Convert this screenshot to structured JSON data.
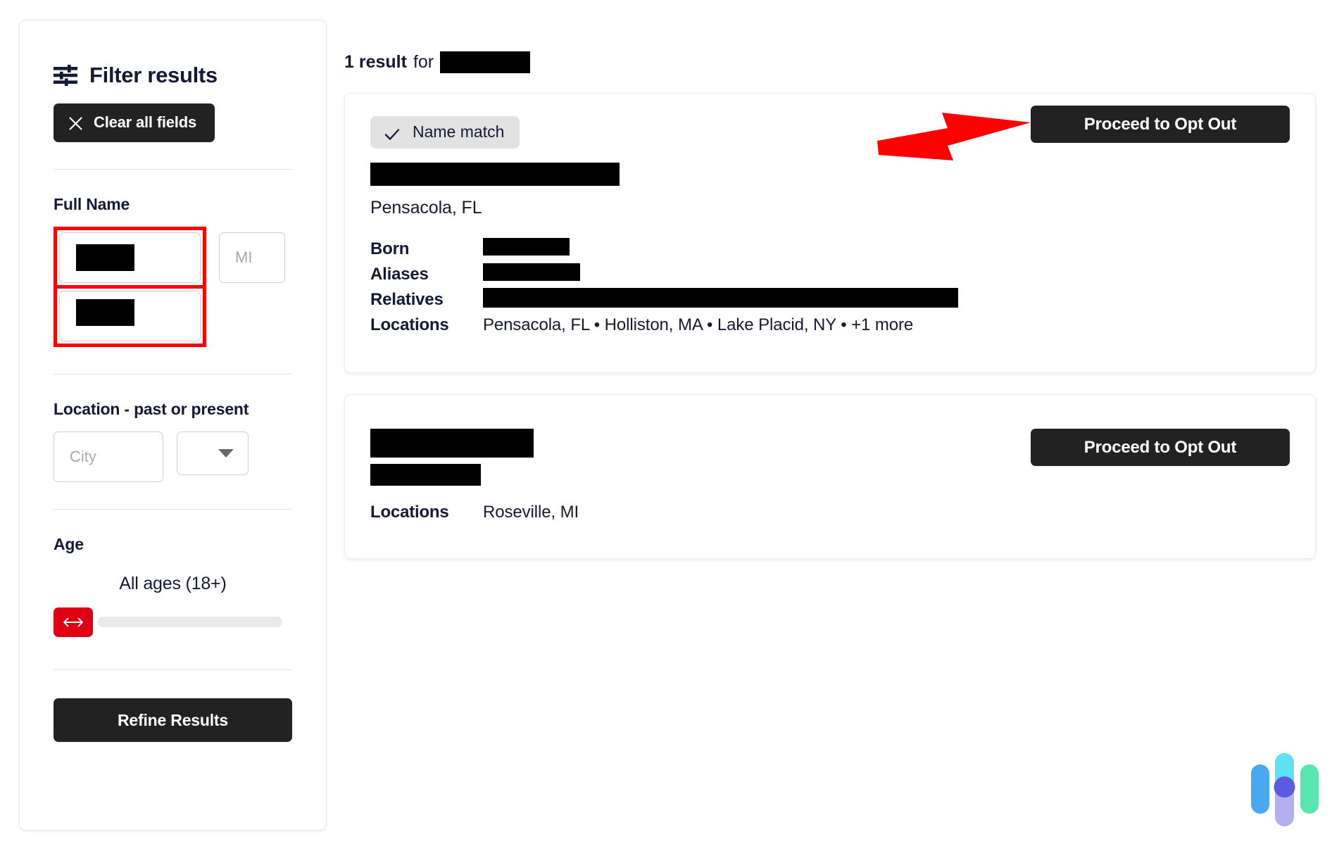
{
  "sidebar": {
    "title": "Filter results",
    "filter_icon": "sliders-icon",
    "clear_button": {
      "label": "Clear all fields",
      "icon": "close-icon"
    },
    "full_name": {
      "label": "Full Name",
      "first_name_value": "[REDACTED]",
      "last_name_value": "[REDACTED]",
      "mi_placeholder": "MI",
      "mi_value": "",
      "highlight_color": "#ff0000"
    },
    "location": {
      "label": "Location - past or present",
      "city_placeholder": "City",
      "city_value": "",
      "state_selected": "",
      "state_icon": "chevron-down-icon"
    },
    "age": {
      "label": "Age",
      "value_text": "All ages (18+)",
      "handle_icon": "left-right-arrows-icon",
      "handle_color": "#e00014",
      "track_color": "#e9e9e9"
    },
    "refine_button": {
      "label": "Refine Results"
    }
  },
  "main": {
    "results_header": {
      "count_text": "1 result",
      "for_text": "for",
      "query": "[REDACTED]"
    },
    "cards": [
      {
        "badge": {
          "label": "Name match",
          "icon": "check-icon"
        },
        "name": "[REDACTED]",
        "city_state": "Pensacola, FL",
        "details": [
          {
            "key": "Born",
            "value": "[REDACTED]",
            "redacted": true
          },
          {
            "key": "Aliases",
            "value": "[REDACTED]",
            "redacted": true
          },
          {
            "key": "Relatives",
            "value": "[REDACTED]",
            "redacted": true
          },
          {
            "key": "Locations",
            "value": "Pensacola, FL • Holliston, MA • Lake Placid, NY • +1 more",
            "redacted": false
          }
        ],
        "optout_button": "Proceed to Opt Out"
      },
      {
        "name": "[REDACTED]",
        "subname": "[REDACTED]",
        "details": [
          {
            "key": "Locations",
            "value": "Roseville, MI",
            "redacted": false
          }
        ],
        "optout_button": "Proceed to Opt Out"
      }
    ]
  },
  "annotations": {
    "arrow": {
      "name": "red-arrow-pointer",
      "color": "#ff0000",
      "points_to": "Proceed to Opt Out"
    }
  },
  "widget": {
    "name": "chat-widget-logo",
    "colors": [
      "#4aa8f0",
      "#5ce1f5",
      "#b3aef0",
      "#5b5be0",
      "#58e5b0"
    ]
  }
}
